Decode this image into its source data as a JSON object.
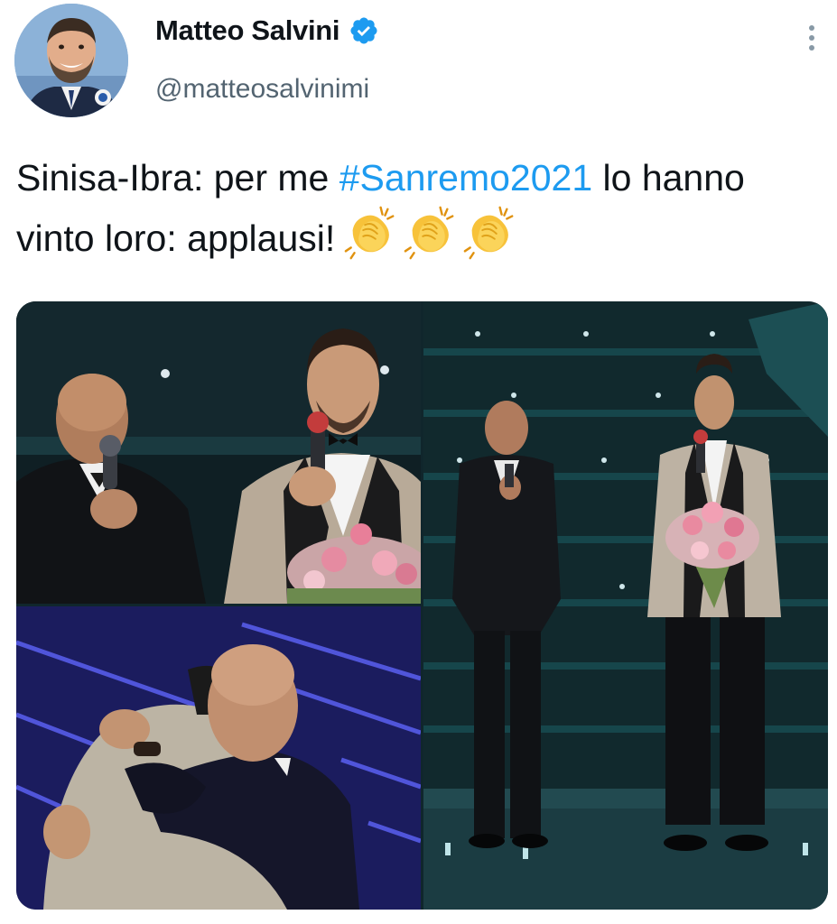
{
  "author": {
    "name": "Matteo Salvini",
    "handle": "@matteosalvinimi",
    "verified": true,
    "avatar_icon": "profile-photo"
  },
  "menu": {
    "icon": "more-vertical-icon"
  },
  "tweet": {
    "text_before": "Sinisa-Ibra: per me ",
    "hashtag": "#Sanremo2021",
    "text_after": " lo hanno vinto loro: applausi!",
    "emoji": [
      "clapping-hands",
      "clapping-hands",
      "clapping-hands"
    ]
  },
  "media": {
    "count": 3,
    "photos": [
      "two-men-with-microphones-closeup",
      "two-men-on-stage-full-length",
      "two-men-hugging"
    ]
  },
  "colors": {
    "hashtag": "#1d9bf0",
    "verified": "#1d9bf0",
    "handle": "#536471",
    "text": "#0f1419"
  }
}
